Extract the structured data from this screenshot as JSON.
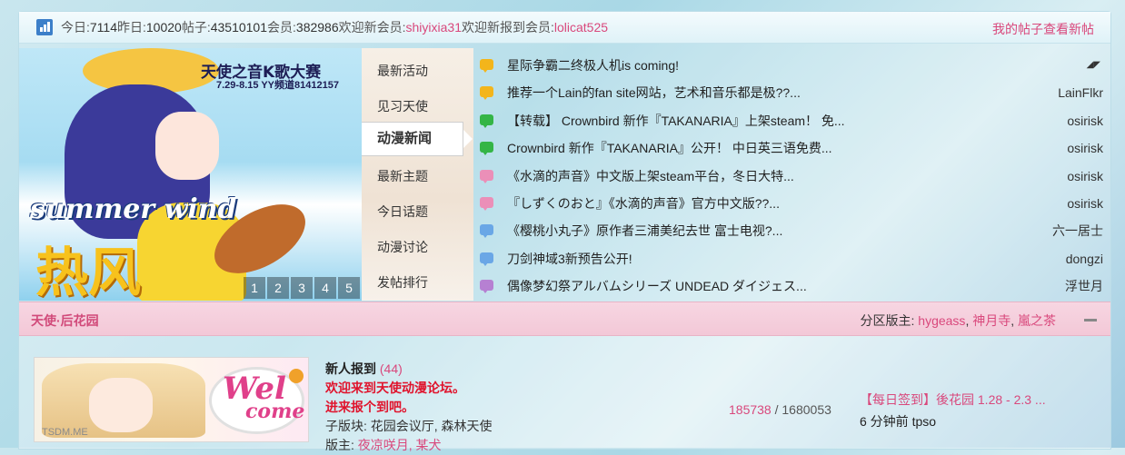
{
  "stats": {
    "today_label": "今日: ",
    "today_value": "7114",
    "yesterday_label": "昨日: ",
    "yesterday_value": "10020",
    "posts_label": "帖子: ",
    "posts_value": "43510101",
    "members_label": "会员: ",
    "members_value": "382986",
    "welcome_label": "欢迎新会员: ",
    "welcome_user": "shiyixia31",
    "newreg_label": "欢迎新报到会员: ",
    "newreg_user": "lolicat525",
    "right_links": "我的帖子查看新帖"
  },
  "banner": {
    "title": "天使之音K歌大赛",
    "subtitle": "7.29-8.15 YY频道81412157",
    "summer_text": "summer wind",
    "big_text": "热风",
    "pages": [
      "1",
      "2",
      "3",
      "4",
      "5"
    ]
  },
  "tabs": [
    {
      "label": "最新活动"
    },
    {
      "label": "见习天使"
    },
    {
      "label": "动漫新闻",
      "active": true
    },
    {
      "label": "最新主题"
    },
    {
      "label": "今日话题"
    },
    {
      "label": "动漫讨论"
    },
    {
      "label": "发帖排行"
    }
  ],
  "news": [
    {
      "title": "星际争霸二终极人机is coming!",
      "author": "",
      "icon": "yellow",
      "corner": "◢◤"
    },
    {
      "title": "推荐一个Lain的fan site网站，艺术和音乐都是极??...",
      "author": "LainFlkr",
      "icon": "yellow"
    },
    {
      "title": "【转载】 Crownbird 新作『TAKANARIA』上架steam！ 免...",
      "author": "osirisk",
      "icon": "green"
    },
    {
      "title": "Crownbird 新作『TAKANARIA』公开！ 中日英三语免费...",
      "author": "osirisk",
      "icon": "green"
    },
    {
      "title": "《水滴的声音》中文版上架steam平台，冬日大特...",
      "author": "osirisk",
      "icon": "pink"
    },
    {
      "title": "『しずくのおと』《水滴的声音》官方中文版??...",
      "author": "osirisk",
      "icon": "pink"
    },
    {
      "title": "《樱桃小丸子》原作者三浦美纪去世 富士电视?...",
      "author": "六一居士",
      "icon": "blue"
    },
    {
      "title": "刀剑神域3新预告公开!",
      "author": "dongzi",
      "icon": "blue"
    },
    {
      "title": "偶像梦幻祭アルバムシリーズ UNDEAD ダイジェス...",
      "author": "浮世月",
      "icon": "purple"
    }
  ],
  "section": {
    "title": "天使·后花园",
    "mods_label": "分区版主: ",
    "mods": [
      "hygeass",
      "神月寺",
      "嵐之茶"
    ],
    "mod_sep": ", "
  },
  "forum": {
    "welcome_tag": "TSDM.ME",
    "welcome_w": "Wel",
    "welcome_come": "come",
    "name": "新人报到",
    "count": "(44)",
    "desc1": "欢迎来到天使动漫论坛。",
    "desc2": "进来报个到吧。",
    "sub_label": "子版块: ",
    "sub_value": "花园会议厅, 森林天使",
    "mod_label": "版主: ",
    "mod_value": "夜凉咲月, 某犬",
    "threads": "185738",
    "stat_sep": " / ",
    "posts": "1680053",
    "last_title": "【每日签到】後花园 1.28 - 2.3 ...",
    "last_meta": "6 分钟前 tpso"
  },
  "colors": {
    "accent_pink": "#d9487c",
    "icon_yellow": "#f3b51b",
    "icon_green": "#34b546",
    "icon_pink": "#eb8fb8",
    "icon_blue": "#6aa7e6",
    "icon_purple": "#b680d2"
  }
}
